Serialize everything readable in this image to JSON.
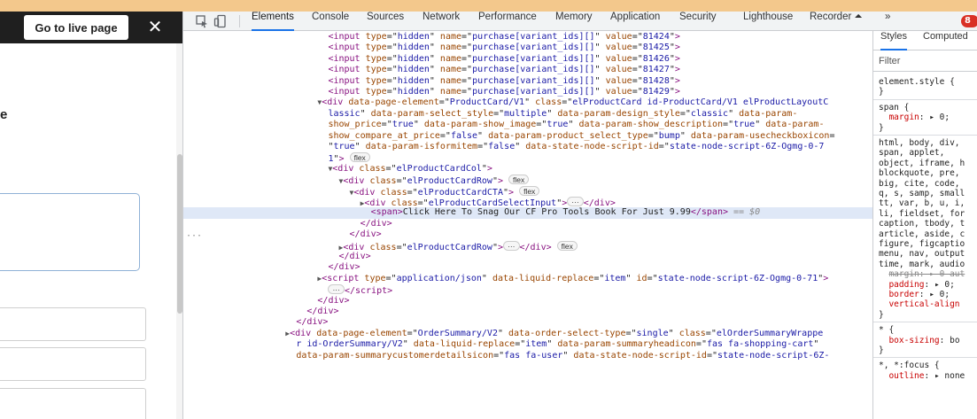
{
  "page": {
    "live_button": "Go to live page",
    "close": "✕",
    "fragment": "e"
  },
  "devtools": {
    "tabs": [
      "Elements",
      "Console",
      "Sources",
      "Network",
      "Performance",
      "Memory",
      "Application",
      "Security",
      "Lighthouse",
      "Recorder ⏶",
      "»"
    ],
    "active_tab": "Elements",
    "error_count": "8",
    "styles_tabs": [
      "Styles",
      "Computed"
    ],
    "filter_placeholder": "Filter"
  },
  "dom_lines": [
    {
      "indent": 23,
      "html": "<span class=\"tg\">&lt;input</span> <span class=\"an\">type</span>=\"<span class=\"av\">hidden</span>\" <span class=\"an\">name</span>=\"<span class=\"av\">purchase[variant_ids][]</span>\" <span class=\"an\">value</span>=\"<span class=\"av\">81424</span>\"<span class=\"tg\">&gt;</span>"
    },
    {
      "indent": 23,
      "html": "<span class=\"tg\">&lt;input</span> <span class=\"an\">type</span>=\"<span class=\"av\">hidden</span>\" <span class=\"an\">name</span>=\"<span class=\"av\">purchase[variant_ids][]</span>\" <span class=\"an\">value</span>=\"<span class=\"av\">81425</span>\"<span class=\"tg\">&gt;</span>"
    },
    {
      "indent": 23,
      "html": "<span class=\"tg\">&lt;input</span> <span class=\"an\">type</span>=\"<span class=\"av\">hidden</span>\" <span class=\"an\">name</span>=\"<span class=\"av\">purchase[variant_ids][]</span>\" <span class=\"an\">value</span>=\"<span class=\"av\">81426</span>\"<span class=\"tg\">&gt;</span>"
    },
    {
      "indent": 23,
      "html": "<span class=\"tg\">&lt;input</span> <span class=\"an\">type</span>=\"<span class=\"av\">hidden</span>\" <span class=\"an\">name</span>=\"<span class=\"av\">purchase[variant_ids][]</span>\" <span class=\"an\">value</span>=\"<span class=\"av\">81427</span>\"<span class=\"tg\">&gt;</span>"
    },
    {
      "indent": 23,
      "html": "<span class=\"tg\">&lt;input</span> <span class=\"an\">type</span>=\"<span class=\"av\">hidden</span>\" <span class=\"an\">name</span>=\"<span class=\"av\">purchase[variant_ids][]</span>\" <span class=\"an\">value</span>=\"<span class=\"av\">81428</span>\"<span class=\"tg\">&gt;</span>"
    },
    {
      "indent": 23,
      "html": "<span class=\"tg\">&lt;input</span> <span class=\"an\">type</span>=\"<span class=\"av\">hidden</span>\" <span class=\"an\">name</span>=\"<span class=\"av\">purchase[variant_ids][]</span>\" <span class=\"an\">value</span>=\"<span class=\"av\">81429</span>\"<span class=\"tg\">&gt;</span>"
    },
    {
      "indent": 21,
      "html": "<span class=\"tri\">▼</span><span class=\"tg\">&lt;div</span> <span class=\"an\">data-page-element</span>=\"<span class=\"av\">ProductCard/V1</span>\" <span class=\"an\">class</span>=\"<span class=\"av\">elProductCard id-ProductCard/V1 elProductLayoutC</span>"
    },
    {
      "indent": 23,
      "html": "<span class=\"av\">lassic</span>\" <span class=\"an\">data-param-select_style</span>=\"<span class=\"av\">multiple</span>\" <span class=\"an\">data-param-design_style</span>=\"<span class=\"av\">classic</span>\" <span class=\"an\">data-param-</span>"
    },
    {
      "indent": 23,
      "html": "<span class=\"an\">show_price</span>=\"<span class=\"av\">true</span>\" <span class=\"an\">data-param-show_image</span>=\"<span class=\"av\">true</span>\" <span class=\"an\">data-param-show_description</span>=\"<span class=\"av\">true</span>\" <span class=\"an\">data-param-</span>"
    },
    {
      "indent": 23,
      "html": "<span class=\"an\">show_compare_at_price</span>=\"<span class=\"av\">false</span>\" <span class=\"an\">data-param-product_select_type</span>=\"<span class=\"av\">bump</span>\" <span class=\"an\">data-param-usecheckboxicon</span>="
    },
    {
      "indent": 23,
      "html": "\"<span class=\"av\">true</span>\" <span class=\"an\">data-param-isformitem</span>=\"<span class=\"av\">false</span>\" <span class=\"an\">data-state-node-script-id</span>=\"<span class=\"av\">state-node-script-6Z-Ogmg-0-7</span>"
    },
    {
      "indent": 23,
      "html": "<span class=\"av\">1</span>\"<span class=\"tg\">&gt;</span> <span class=\"pill\">flex</span>"
    },
    {
      "indent": 23,
      "html": "<span class=\"tri\">▼</span><span class=\"tg\">&lt;div</span> <span class=\"an\">class</span>=\"<span class=\"av\">elProductCardCol</span>\"<span class=\"tg\">&gt;</span>"
    },
    {
      "indent": 25,
      "html": "<span class=\"tri\">▼</span><span class=\"tg\">&lt;div</span> <span class=\"an\">class</span>=\"<span class=\"av\">elProductCardRow</span>\"<span class=\"tg\">&gt;</span> <span class=\"pill\">flex</span>"
    },
    {
      "indent": 27,
      "html": "<span class=\"tri\">▼</span><span class=\"tg\">&lt;div</span> <span class=\"an\">class</span>=\"<span class=\"av\">elProductCardCTA</span>\"<span class=\"tg\">&gt;</span> <span class=\"pill\">flex</span>"
    },
    {
      "indent": 29,
      "html": "<span class=\"tri\">▶</span><span class=\"tg\">&lt;div</span> <span class=\"an\">class</span>=\"<span class=\"av\">elProductCardSelectInput</span>\"<span class=\"tg\">&gt;</span><span class=\"pill\">···</span><span class=\"tg\">&lt;/div&gt;</span>"
    },
    {
      "indent": 31,
      "selected": true,
      "html": "<span class=\"tg\">&lt;span&gt;</span>Click Here To Snag Our CF Pro Tools Book For Just 9.99<span class=\"tg\">&lt;/span&gt;</span> <span class=\"eq0\">== $0</span>"
    },
    {
      "indent": 29,
      "html": "<span class=\"tg\">&lt;/div&gt;</span>"
    },
    {
      "indent": 27,
      "html": "<span class=\"tg\">&lt;/div&gt;</span>"
    },
    {
      "indent": 25,
      "html": "<span class=\"tri\">▶</span><span class=\"tg\">&lt;div</span> <span class=\"an\">class</span>=\"<span class=\"av\">elProductCardRow</span>\"<span class=\"tg\">&gt;</span><span class=\"pill\">···</span><span class=\"tg\">&lt;/div&gt;</span> <span class=\"pill\">flex</span>"
    },
    {
      "indent": 25,
      "html": "<span class=\"tg\">&lt;/div&gt;</span>"
    },
    {
      "indent": 23,
      "html": "<span class=\"tg\">&lt;/div&gt;</span>"
    },
    {
      "indent": 21,
      "html": "<span class=\"tri\">▶</span><span class=\"tg\">&lt;script</span> <span class=\"an\">type</span>=\"<span class=\"av\">application/json</span>\" <span class=\"an\">data-liquid-replace</span>=\"<span class=\"av\">item</span>\" <span class=\"an\">id</span>=\"<span class=\"av\">state-node-script-6Z-Ogmg-0-71</span>\"<span class=\"tg\">&gt;</span>"
    },
    {
      "indent": 23,
      "html": "<span class=\"pill\">···</span><span class=\"tg\">&lt;/script&gt;</span>"
    },
    {
      "indent": 21,
      "html": "<span class=\"tg\">&lt;/div&gt;</span>"
    },
    {
      "indent": 19,
      "html": "<span class=\"tg\">&lt;/div&gt;</span>"
    },
    {
      "indent": 17,
      "html": "<span class=\"tg\">&lt;/div&gt;</span>"
    },
    {
      "indent": 15,
      "html": "<span class=\"tri\">▶</span><span class=\"tg\">&lt;div</span> <span class=\"an\">data-page-element</span>=\"<span class=\"av\">OrderSummary/V2</span>\" <span class=\"an\">data-order-select-type</span>=\"<span class=\"av\">single</span>\" <span class=\"an\">class</span>=\"<span class=\"av\">elOrderSummaryWrappe</span>"
    },
    {
      "indent": 17,
      "html": "<span class=\"av\">r id-OrderSummary/V2</span>\" <span class=\"an\">data-liquid-replace</span>=\"<span class=\"av\">item</span>\" <span class=\"an\">data-param-summaryheadicon</span>=\"<span class=\"av\">fas fa-shopping-cart</span>\""
    },
    {
      "indent": 17,
      "html": "<span class=\"an\">data-param-summarycustomerdetailsicon</span>=\"<span class=\"av\">fas fa-user</span>\" <span class=\"an\">data-state-node-script-id</span>=\"<span class=\"av\">state-node-script-6Z-</span>"
    }
  ],
  "styles_lines": [
    {
      "html": "element.style {"
    },
    {
      "html": "}"
    },
    {
      "div": true
    },
    {
      "html": "span {"
    },
    {
      "html": "&nbsp;&nbsp;<span class=\"prop\">margin</span>: ▸ 0;"
    },
    {
      "html": "}"
    },
    {
      "div": true
    },
    {
      "html": "html, body, div,"
    },
    {
      "html": "span, applet,"
    },
    {
      "html": "object, iframe, h"
    },
    {
      "html": "blockquote, pre,"
    },
    {
      "html": "big, cite, code,"
    },
    {
      "html": "q, s, samp, small"
    },
    {
      "html": "tt, var, b, u, i,"
    },
    {
      "html": "li, fieldset, for"
    },
    {
      "html": "caption, tbody, t"
    },
    {
      "html": "article, aside, c"
    },
    {
      "html": "figure, figcaptio"
    },
    {
      "html": "menu, nav, output"
    },
    {
      "html": "time, mark, audio"
    },
    {
      "html": "&nbsp;&nbsp;<span class=\"strike\">margin: ▸ 0 aut</span>"
    },
    {
      "html": "&nbsp;&nbsp;<span class=\"prop\">padding</span>: ▸ 0;"
    },
    {
      "html": "&nbsp;&nbsp;<span class=\"prop\">border</span>: ▸ 0;"
    },
    {
      "html": "&nbsp;&nbsp;<span class=\"prop\">vertical-align</span>"
    },
    {
      "html": "}"
    },
    {
      "div": true
    },
    {
      "html": "* {"
    },
    {
      "html": "&nbsp;&nbsp;<span class=\"prop\">box-sizing</span>: bo"
    },
    {
      "html": "}"
    },
    {
      "div": true
    },
    {
      "html": "*, *:focus {"
    },
    {
      "html": "&nbsp;&nbsp;<span class=\"prop\">outline</span>: ▸ none"
    }
  ]
}
